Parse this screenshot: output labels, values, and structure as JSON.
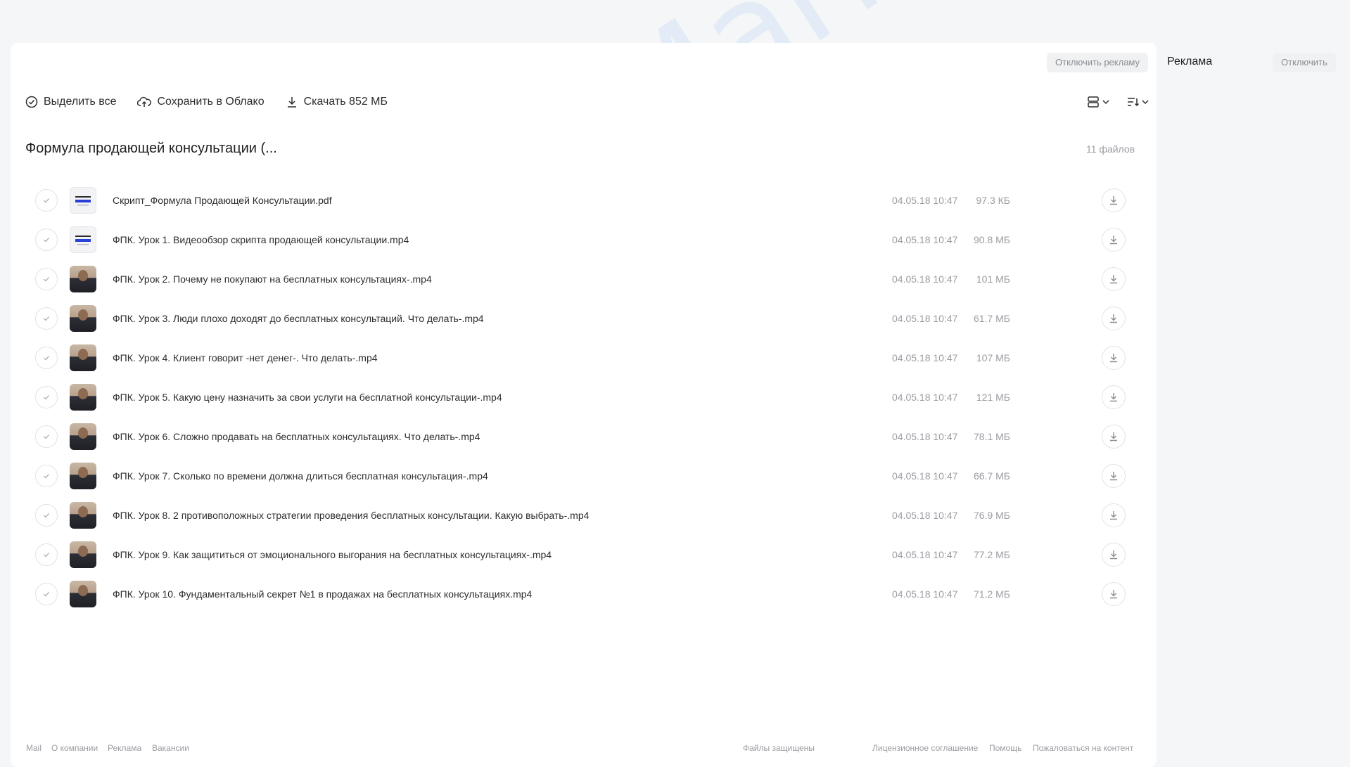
{
  "ads": {
    "disable_ads": "Отключить рекламу",
    "title": "Реклама",
    "disable": "Отключить"
  },
  "toolbar": {
    "select_all": "Выделить все",
    "save_cloud": "Сохранить в Облако",
    "download": "Скачать 852 МБ"
  },
  "folder": {
    "title": "Формула продающей консультации (...",
    "count": "11 файлов"
  },
  "files": [
    {
      "name": "Скрипт_Формула Продающей Консультации.pdf",
      "date": "04.05.18 10:47",
      "size": "97.3 КБ",
      "thumb": "doc"
    },
    {
      "name": "ФПК. Урок 1. Видеообзор скрипта продающей консультации.mp4",
      "date": "04.05.18 10:47",
      "size": "90.8 МБ",
      "thumb": "doc"
    },
    {
      "name": "ФПК. Урок 2. Почему не покупают на бесплатных консультациях-.mp4",
      "date": "04.05.18 10:47",
      "size": "101 МБ",
      "thumb": "person"
    },
    {
      "name": "ФПК. Урок 3. Люди плохо доходят до бесплатных консультаций. Что делать-.mp4",
      "date": "04.05.18 10:47",
      "size": "61.7 МБ",
      "thumb": "person"
    },
    {
      "name": "ФПК. Урок 4. Клиент говорит -нет денег-. Что делать-.mp4",
      "date": "04.05.18 10:47",
      "size": "107 МБ",
      "thumb": "person"
    },
    {
      "name": "ФПК. Урок 5. Какую цену назначить за свои услуги на бесплатной консультации-.mp4",
      "date": "04.05.18 10:47",
      "size": "121 МБ",
      "thumb": "person"
    },
    {
      "name": "ФПК. Урок 6. Сложно продавать на бесплатных консультациях. Что делать-.mp4",
      "date": "04.05.18 10:47",
      "size": "78.1 МБ",
      "thumb": "person"
    },
    {
      "name": "ФПК. Урок 7. Сколько по времени должна длиться бесплатная консультация-.mp4",
      "date": "04.05.18 10:47",
      "size": "66.7 МБ",
      "thumb": "person"
    },
    {
      "name": "ФПК. Урок 8. 2 противоположных стратегии проведения бесплатных консультации. Какую выбрать-.mp4",
      "date": "04.05.18 10:47",
      "size": "76.9 МБ",
      "thumb": "person"
    },
    {
      "name": "ФПК. Урок 9. Как защититься от эмоционального выгорания на бесплатных консультациях-.mp4",
      "date": "04.05.18 10:47",
      "size": "77.2 МБ",
      "thumb": "person"
    },
    {
      "name": "ФПК. Урок 10. Фундаментальный секрет №1 в продажах на бесплатных консультациях.mp4",
      "date": "04.05.18 10:47",
      "size": "71.2 МБ",
      "thumb": "person"
    }
  ],
  "footer": {
    "mail": "Mail",
    "about": "О компании",
    "ads": "Реклама",
    "jobs": "Вакансии",
    "protected": "Файлы защищены",
    "license": "Лицензионное соглашение",
    "help": "Помощь",
    "report": "Пожаловаться на контент"
  },
  "watermark": "ZnaniyaMarket.club",
  "colors": {
    "accent": "#0077ff",
    "muted": "#9a9ca1"
  }
}
